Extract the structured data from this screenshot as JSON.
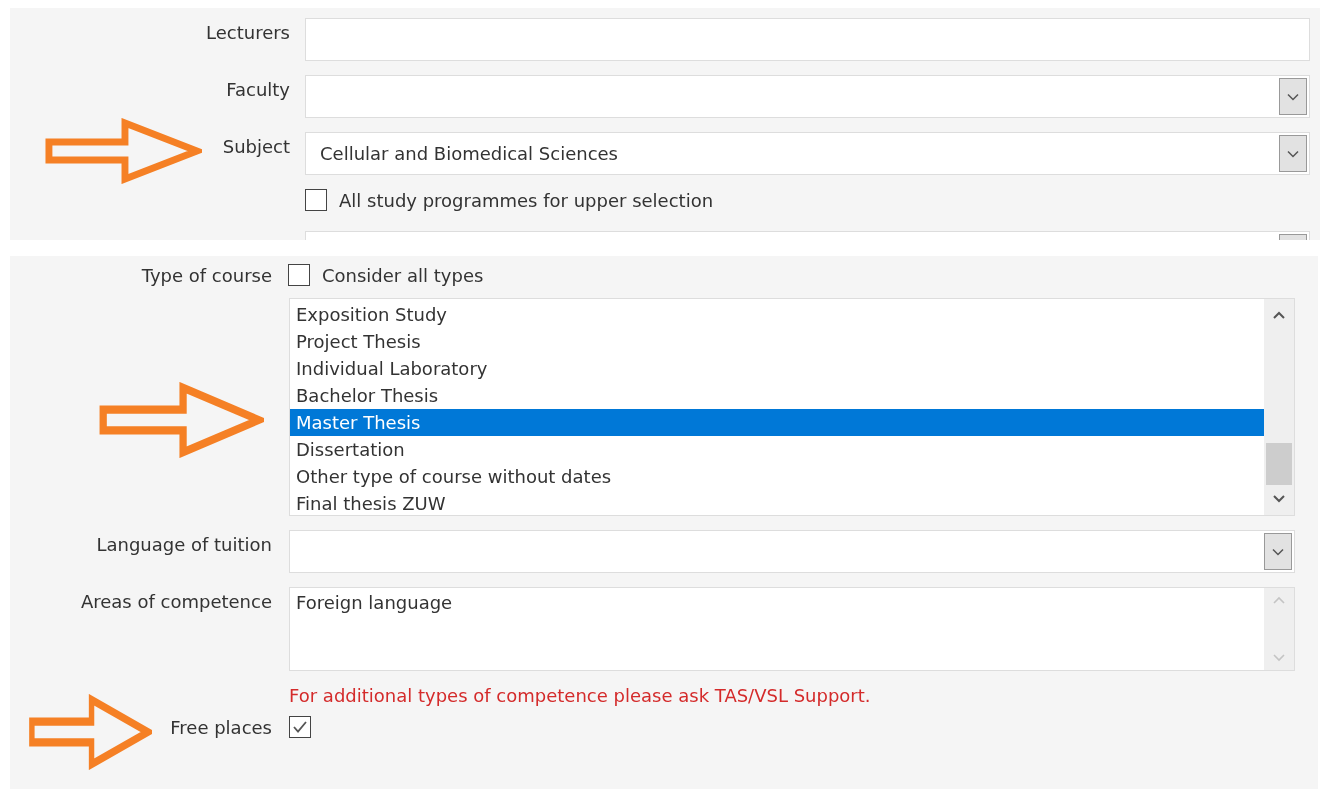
{
  "top_panel": {
    "fields": [
      {
        "label": "Lecturers",
        "kind": "text",
        "arrow": false
      },
      {
        "label": "Faculty",
        "kind": "select",
        "arrow": false
      },
      {
        "label": "Subject",
        "kind": "select",
        "value": "Cellular and Biomedical Sciences",
        "arrow": true
      }
    ],
    "checkbox": {
      "label": "All study programmes for upper selection",
      "checked": false
    }
  },
  "bottom_panel": {
    "type_of_course": {
      "label": "Type of course",
      "checkbox": {
        "label": "Consider all types",
        "checked": false
      },
      "arrow": true,
      "items": [
        {
          "label": "Exposition Study",
          "selected": false
        },
        {
          "label": "Project Thesis",
          "selected": false
        },
        {
          "label": "Individual Laboratory",
          "selected": false
        },
        {
          "label": "Bachelor Thesis",
          "selected": false
        },
        {
          "label": "Master Thesis",
          "selected": true
        },
        {
          "label": "Dissertation",
          "selected": false
        },
        {
          "label": "Other type of course without dates",
          "selected": false
        },
        {
          "label": "Final thesis ZUW",
          "selected": false
        }
      ]
    },
    "language": {
      "label": "Language of tuition"
    },
    "competence": {
      "label": "Areas of competence",
      "value": "Foreign language"
    },
    "note": "For additional types of competence please ask TAS/VSL Support.",
    "free_places": {
      "label": "Free places",
      "checked": true,
      "arrow": true
    }
  }
}
